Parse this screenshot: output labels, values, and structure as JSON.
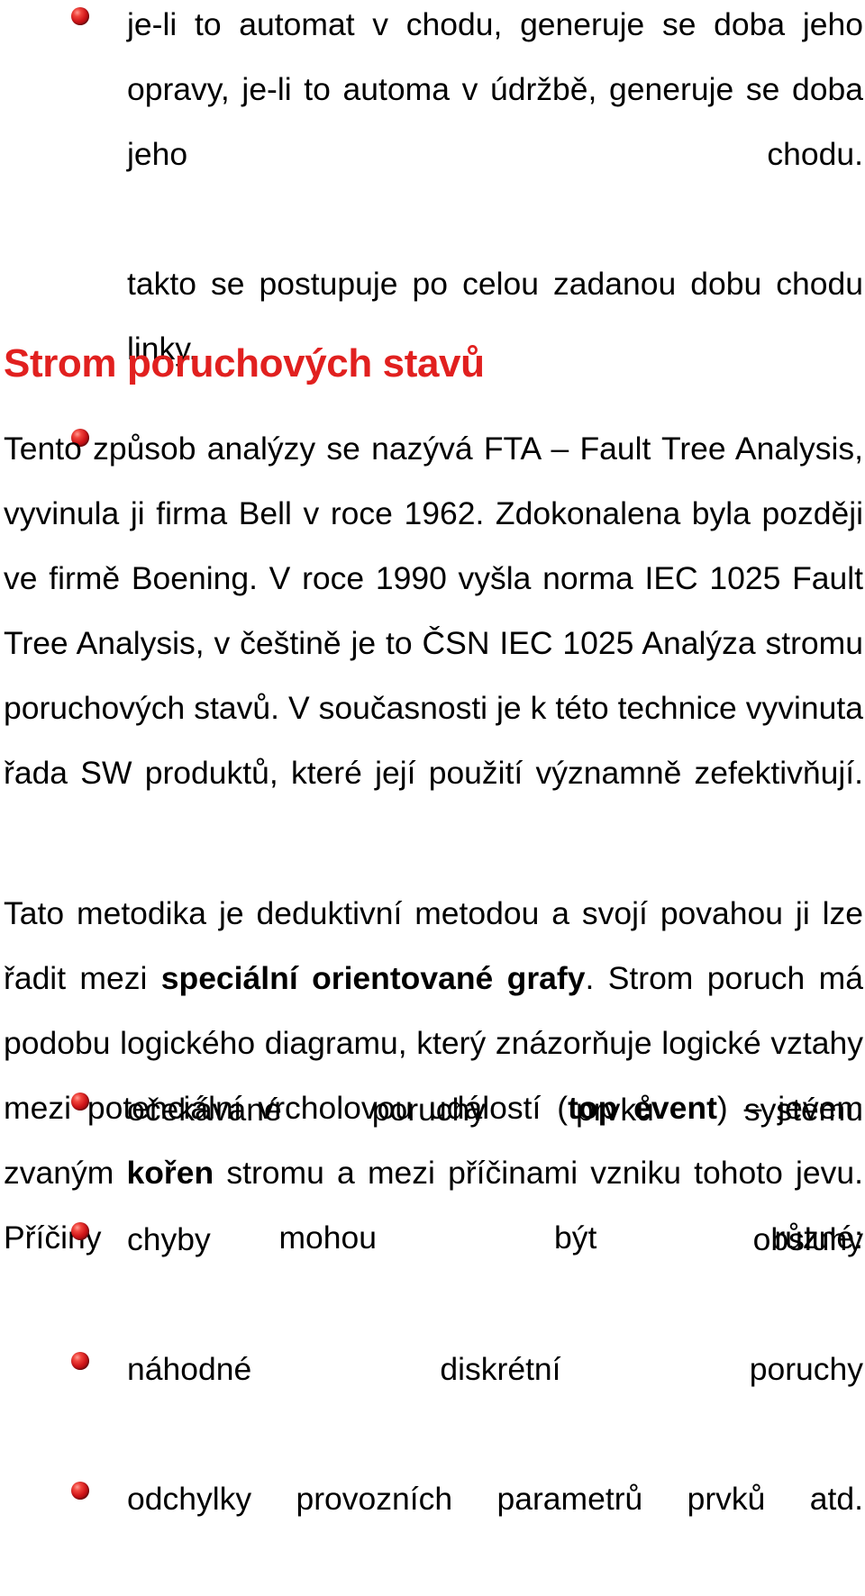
{
  "document": {
    "language": "cs",
    "page_background": "#ffffff",
    "text_color": "#000000",
    "heading_color": "#E1201F",
    "bullet_color": "#C01418",
    "bullet_icon": "red-sphere-bullet-icon"
  },
  "top_bullets": {
    "items": [
      "je-li to automat v chodu, generuje se doba jeho opravy, je-li to automa v údržbě, generuje se doba jeho chodu.",
      "takto se postupuje po celou zadanou dobu chodu linky."
    ]
  },
  "heading": {
    "text": "Strom poruchových stavů"
  },
  "paragraphs": [
    {
      "id": "para-fta",
      "runs": [
        {
          "text": "Tento způsob analýzy se nazývá FTA – Fault Tree Analysis, vyvinula ji firma Bell v roce 1962. Zdokonalena byla později ve firmě Boening. V roce 1990 vyšla norma IEC 1025 Fault Tree Analysis, v češtině je to ČSN IEC 1025 Analýza stromu poruchových stavů. V současnosti je k této technice vyvinuta řada SW produktů, které její použití významně zefektivňují.",
          "bold": false
        }
      ]
    },
    {
      "id": "para-metodika",
      "runs": [
        {
          "text": "Tato metodika je deduktivní metodou a svojí povahou ji lze řadit mezi ",
          "bold": false
        },
        {
          "text": "speciální orientované grafy",
          "bold": true
        },
        {
          "text": ". Strom poruch má podobu logického diagramu, který znázorňuje logické vztahy mezi potenciální vrcholovou událostí (",
          "bold": false
        },
        {
          "text": "top event",
          "bold": true
        },
        {
          "text": ") – jevem zvaným ",
          "bold": false
        },
        {
          "text": "kořen",
          "bold": true
        },
        {
          "text": " stromu a mezi příčinami vzniku tohoto jevu. Příčiny mohou být různé:",
          "bold": false
        }
      ]
    }
  ],
  "end_bullets": {
    "items": [
      "očekávané poruchy prvků systému",
      "chyby obsluhy",
      "náhodné diskrétní poruchy",
      "odchylky provozních parametrů prvků atd."
    ]
  }
}
